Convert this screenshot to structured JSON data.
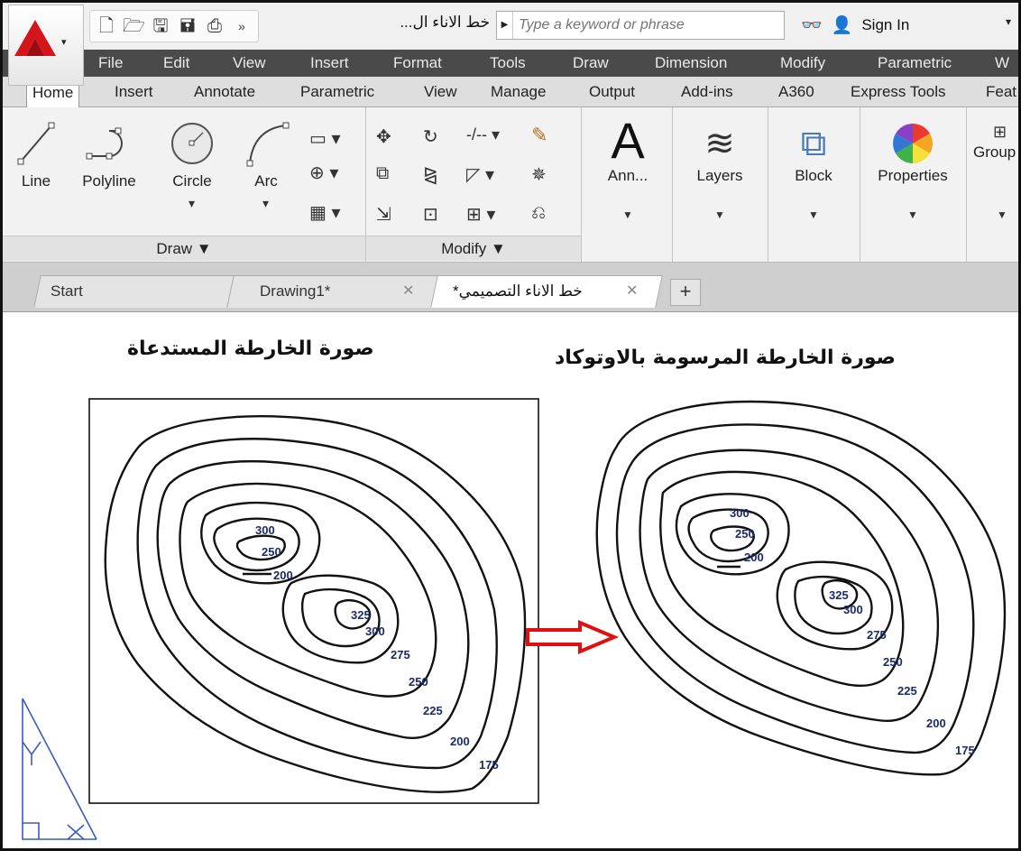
{
  "titlebar": {
    "document_title": "...خط الاناء ال",
    "search_placeholder": "Type a keyword or phrase",
    "sign_in_label": "Sign In"
  },
  "menu": [
    "File",
    "Edit",
    "View",
    "Insert",
    "Format",
    "Tools",
    "Draw",
    "Dimension",
    "Modify",
    "Parametric",
    "W"
  ],
  "ribbon_tabs": [
    "Home",
    "Insert",
    "Annotate",
    "Parametric",
    "View",
    "Manage",
    "Output",
    "Add-ins",
    "A360",
    "Express Tools",
    "Feat"
  ],
  "draw_panel": {
    "line": "Line",
    "polyline": "Polyline",
    "circle": "Circle",
    "arc": "Arc",
    "title": "Draw ▼"
  },
  "modify_panel": {
    "title": "Modify ▼"
  },
  "big_tools": {
    "annotation": "Ann...",
    "layers": "Layers",
    "block": "Block",
    "properties": "Properties",
    "group": "Group"
  },
  "file_tabs": {
    "start": "Start",
    "drawing1": "Drawing1*",
    "active": "خط الاناء التصميمي*"
  },
  "drawing": {
    "caption_left": "صورة الخارطة المستدعاة",
    "caption_right": "صورة الخارطة المرسومة بالاوتوكاد",
    "contour_labels_left": [
      "300",
      "250",
      "200",
      "325",
      "300",
      "275",
      "250",
      "225",
      "200",
      "175"
    ],
    "contour_labels_right": [
      "300",
      "250",
      "200",
      "325",
      "300",
      "275",
      "250",
      "225",
      "200",
      "175"
    ],
    "arrow_color": "#e01010"
  }
}
